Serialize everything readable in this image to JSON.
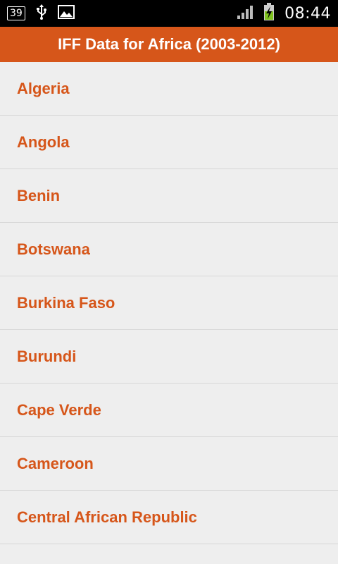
{
  "status_bar": {
    "notification_count": "39",
    "time": "08:44",
    "icons": [
      "notification-count-icon",
      "usb-icon",
      "image-icon",
      "signal-icon",
      "battery-charging-icon"
    ]
  },
  "app_bar": {
    "title": "IFF Data for Africa (2003-2012)"
  },
  "countries": [
    "Algeria",
    "Angola",
    "Benin",
    "Botswana",
    "Burkina Faso",
    "Burundi",
    "Cape Verde",
    "Cameroon",
    "Central African Republic"
  ],
  "colors": {
    "accent": "#d6561a",
    "background": "#eeeeee",
    "status_bar": "#000000"
  }
}
